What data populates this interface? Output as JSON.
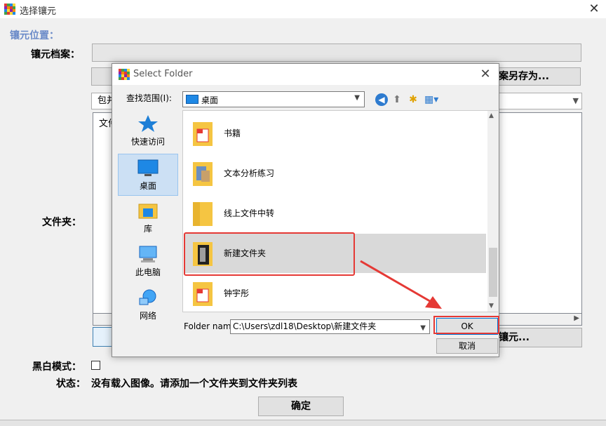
{
  "main_window": {
    "title": "选择镶元",
    "close_glyph": "✕",
    "section_label": "镶元位置：",
    "archive_label": "镶元档案：",
    "archive_value": "",
    "save_as_label": "案另存为...",
    "include_select_value": "包并",
    "folder_list_text": "文件",
    "folder_label": "文件夹：",
    "add_image_label": "镶元...",
    "bw_label": "黑白模式：",
    "status_label": "状态：",
    "status_text": "没有载入图像。请添加一个文件夹到文件夹列表",
    "confirm_label": "确定"
  },
  "dialog": {
    "title": "Select Folder",
    "close_glyph": "✕",
    "lookin_label": "查找范围(I):",
    "lookin_value": "桌面",
    "places": [
      {
        "label": "快速访问",
        "icon": "star-icon"
      },
      {
        "label": "桌面",
        "icon": "desktop-icon"
      },
      {
        "label": "库",
        "icon": "library-icon"
      },
      {
        "label": "此电脑",
        "icon": "computer-icon"
      },
      {
        "label": "网络",
        "icon": "network-icon"
      }
    ],
    "items": [
      {
        "name": "书籍"
      },
      {
        "name": "文本分析练习"
      },
      {
        "name": "线上文件中转"
      },
      {
        "name": "新建文件夹",
        "selected": true
      },
      {
        "name": "钟宇彤"
      }
    ],
    "folder_name_label": "Folder name:",
    "folder_name_value": "C:\\Users\\zdl18\\Desktop\\新建文件夹",
    "ok_label": "OK",
    "cancel_label": "取消"
  },
  "colors": {
    "annotation_red": "#e53935",
    "selection_gray": "#d9d9d9",
    "accent_blue": "#0078d7"
  }
}
